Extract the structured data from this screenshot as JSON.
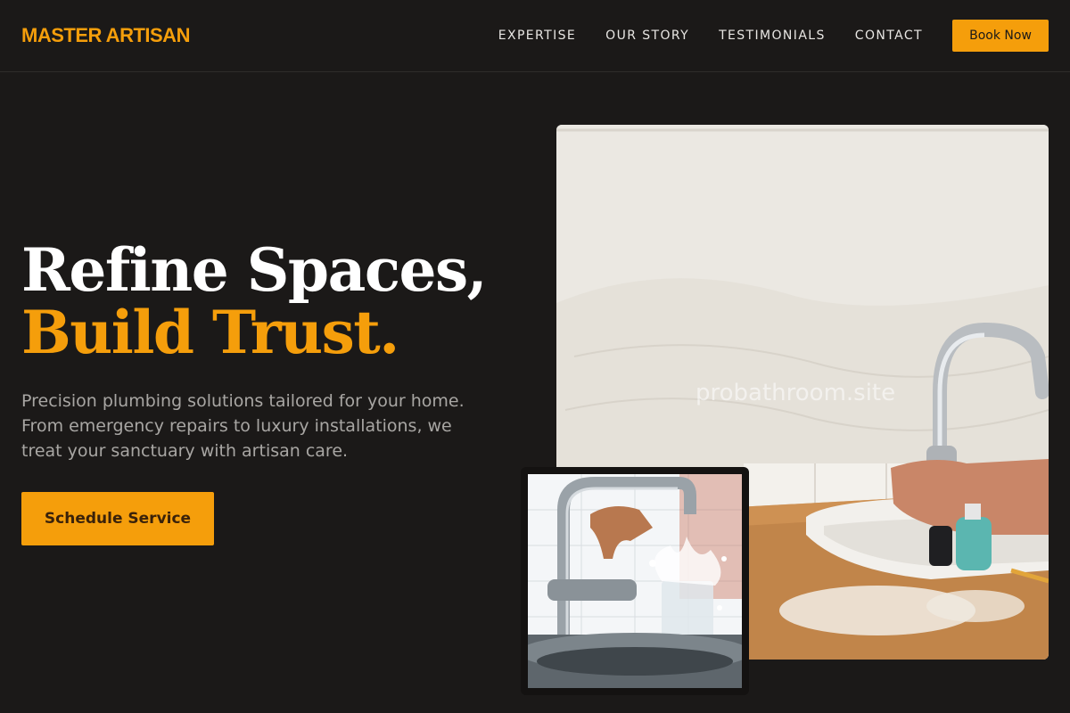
{
  "header": {
    "brand": "MASTER ARTISAN",
    "nav": [
      "EXPERTISE",
      "OUR STORY",
      "TESTIMONIALS",
      "CONTACT"
    ],
    "book_label": "Book Now"
  },
  "hero": {
    "title_line1": "Refine Spaces,",
    "title_line2": "Build Trust.",
    "subtitle": "Precision plumbing solutions tailored for your home. From emergency repairs to luxury installations, we treat your sanctuary with artisan care.",
    "cta_label": "Schedule Service"
  },
  "images": {
    "main_watermark": "probathroom.site"
  },
  "colors": {
    "accent": "#f59e0b",
    "background": "#1b1918",
    "muted_text": "#a8a6a3"
  }
}
